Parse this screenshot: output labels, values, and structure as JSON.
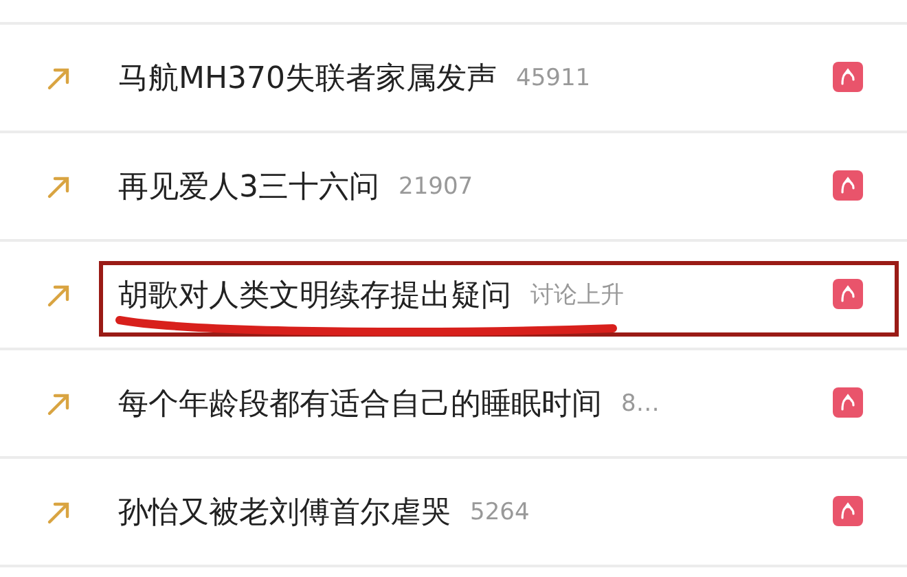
{
  "hot_list": [
    {
      "title": "马航MH370失联者家属发声",
      "count": "45911",
      "annotated": false
    },
    {
      "title": "再见爱人3三十六问",
      "count": "21907",
      "annotated": false
    },
    {
      "title": "胡歌对人类文明续存提出疑问",
      "count": "讨论上升",
      "annotated": true
    },
    {
      "title": "每个年龄段都有适合自己的睡眠时间",
      "count": "8…",
      "annotated": false
    },
    {
      "title": "孙怡又被老刘傅首尔虐哭",
      "count": "5264",
      "annotated": false
    }
  ]
}
